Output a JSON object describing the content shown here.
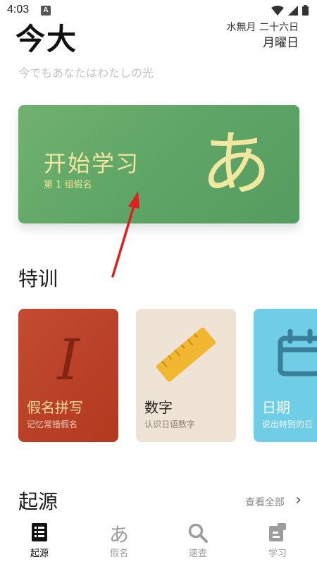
{
  "status": {
    "time": "4:03",
    "notification": "A"
  },
  "header": {
    "title": "今大",
    "date_line1": "水無月 二十六日",
    "date_line2": "月曜日",
    "subtitle": "今でもあなたはわたしの光"
  },
  "start_card": {
    "title": "开始学习",
    "subtitle": "第 1 组假名",
    "glyph": "あ"
  },
  "special": {
    "section_title": "特训",
    "cards": [
      {
        "title": "假名拼写",
        "subtitle": "记忆常错假名",
        "icon": "italic-i-icon",
        "color": "#b8402a"
      },
      {
        "title": "数字",
        "subtitle": "认识日语数字",
        "icon": "ruler-icon",
        "color": "#efe3d5"
      },
      {
        "title": "日期",
        "subtitle": "说出特别的日",
        "icon": "calendar-icon",
        "color": "#6fcde6"
      }
    ]
  },
  "origin": {
    "section_title": "起源",
    "view_all": "查看全部"
  },
  "tabs": [
    {
      "label": "起源",
      "icon": "list-icon",
      "active": true
    },
    {
      "label": "假名",
      "icon": "kana-icon",
      "active": false
    },
    {
      "label": "速查",
      "icon": "search-icon",
      "active": false
    },
    {
      "label": "学习",
      "icon": "study-icon",
      "active": false
    }
  ]
}
